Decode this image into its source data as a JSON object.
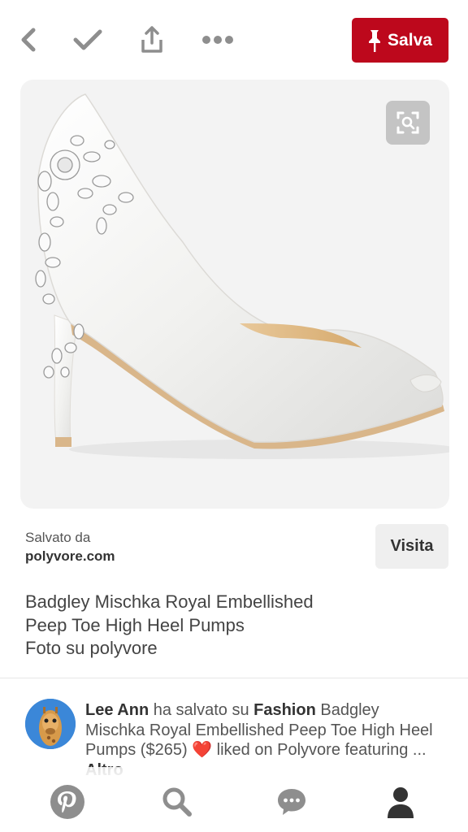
{
  "toolbar": {
    "back_icon": "chevron-left-icon",
    "check_icon": "check-icon",
    "share_icon": "share-icon",
    "more_icon": "more-dots-icon",
    "save_label": "Salva",
    "save_icon": "pushpin-icon",
    "brand_color": "#bd081c"
  },
  "pin": {
    "image_subject": "white satin peep toe high heel pump with crystal embellishment",
    "lens_icon": "visual-search-icon"
  },
  "source": {
    "saved_from_label": "Salvato da",
    "domain": "polyvore.com",
    "visit_label": "Visita"
  },
  "description": {
    "line1": "Badgley Mischka Royal Embellished",
    "line2": "Peep Toe High Heel Pumps",
    "line3": "Foto su polyvore"
  },
  "activity": {
    "user": "Lee Ann",
    "action": " ha salvato su ",
    "board": "Fashion",
    "text": "Badgley Mischka Royal Embellished Peep Toe High Heel Pumps ($265) ",
    "heart": "❤️",
    "cut_text": " liked on Polyvore featuring ... ",
    "more_label": "Altro"
  },
  "bottom_nav": {
    "items": [
      "pinterest-home-icon",
      "search-icon",
      "messages-icon",
      "profile-icon"
    ]
  }
}
